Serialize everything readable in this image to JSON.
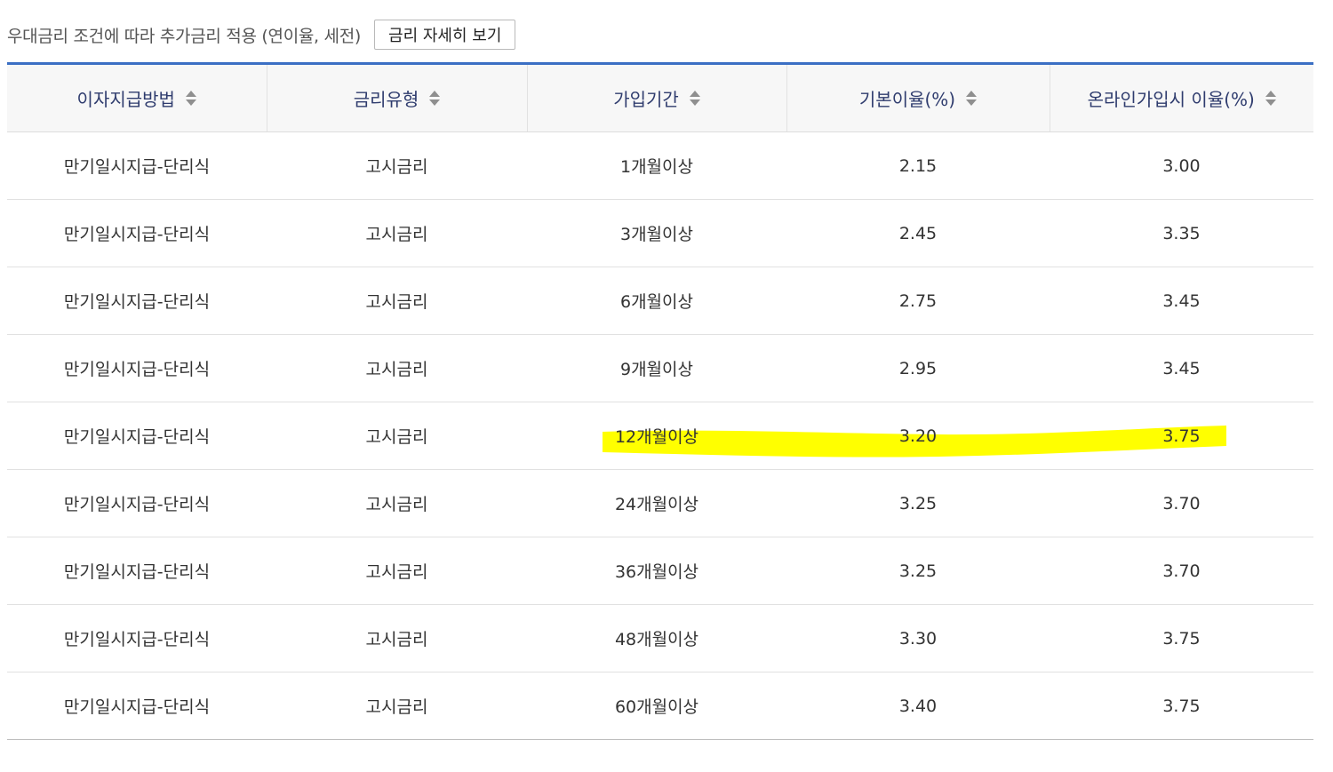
{
  "header": {
    "notice": "우대금리 조건에 따라 추가금리 적용 (연이율, 세전)",
    "detail_button": "금리 자세히 보기"
  },
  "table": {
    "columns": [
      {
        "label": "이자지급방법",
        "sort_icon": "sort-icon"
      },
      {
        "label": "금리유형",
        "sort_icon": "sort-icon"
      },
      {
        "label": "가입기간",
        "sort_icon": "sort-icon"
      },
      {
        "label": "기본이율(%)",
        "sort_icon": "sort-icon"
      },
      {
        "label": "온라인가입시 이율(%)",
        "sort_icon": "sort-icon"
      }
    ],
    "rows": [
      [
        "만기일시지급-단리식",
        "고시금리",
        "1개월이상",
        "2.15",
        "3.00"
      ],
      [
        "만기일시지급-단리식",
        "고시금리",
        "3개월이상",
        "2.45",
        "3.35"
      ],
      [
        "만기일시지급-단리식",
        "고시금리",
        "6개월이상",
        "2.75",
        "3.45"
      ],
      [
        "만기일시지급-단리식",
        "고시금리",
        "9개월이상",
        "2.95",
        "3.45"
      ],
      [
        "만기일시지급-단리식",
        "고시금리",
        "12개월이상",
        "3.20",
        "3.75"
      ],
      [
        "만기일시지급-단리식",
        "고시금리",
        "24개월이상",
        "3.25",
        "3.70"
      ],
      [
        "만기일시지급-단리식",
        "고시금리",
        "36개월이상",
        "3.25",
        "3.70"
      ],
      [
        "만기일시지급-단리식",
        "고시금리",
        "48개월이상",
        "3.30",
        "3.75"
      ],
      [
        "만기일시지급-단리식",
        "고시금리",
        "60개월이상",
        "3.40",
        "3.75"
      ]
    ]
  },
  "colors": {
    "accent_border": "#3b6fc4",
    "header_text": "#2f3c6e",
    "header_bg": "#f7f7f7",
    "highlight": "#ffff00"
  }
}
